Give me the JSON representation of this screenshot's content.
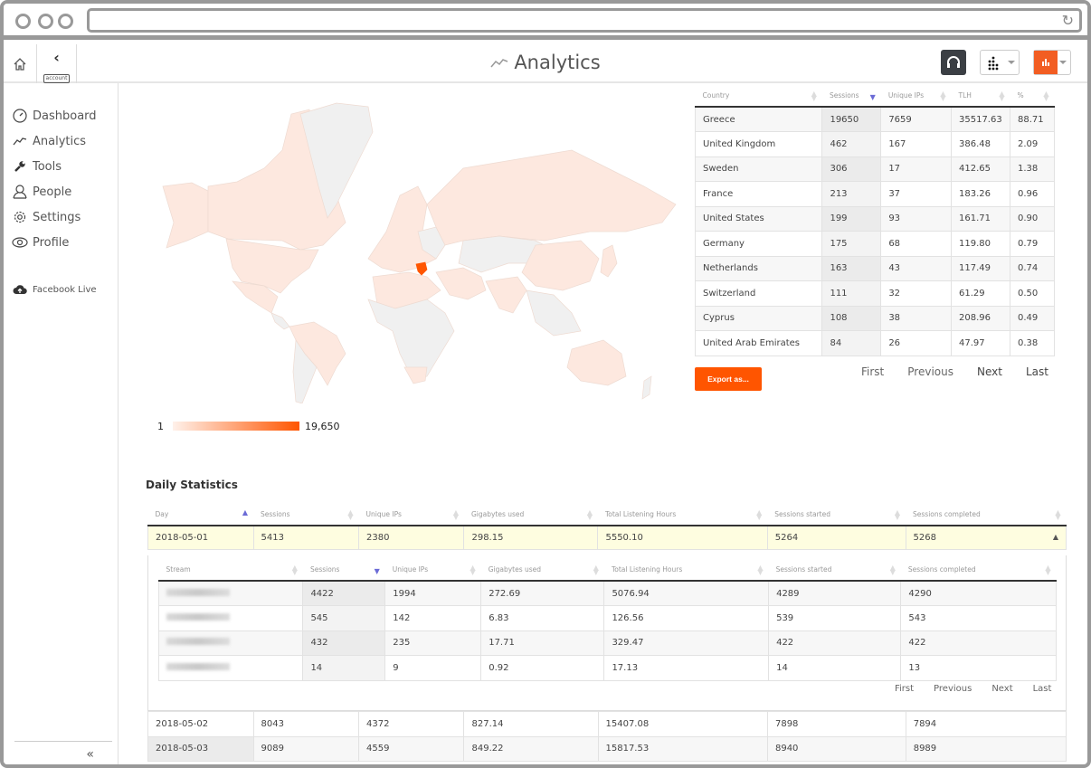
{
  "browser": {
    "url": "",
    "reload_icon": "reload-icon"
  },
  "header": {
    "home_icon": "home-icon",
    "back_icon": "chevron-left-icon",
    "back_label": "account",
    "title": "Analytics",
    "title_icon": "analytics-line-icon",
    "headphones_icon": "headphones-icon",
    "dropdown1_icon": "dots-grid-icon",
    "dropdown2_icon": "bar-chart-icon"
  },
  "sidebar": {
    "items": [
      {
        "label": "Dashboard",
        "icon": "dashboard-gauge-icon"
      },
      {
        "label": "Analytics",
        "icon": "analytics-line-icon"
      },
      {
        "label": "Tools",
        "icon": "wrench-icon"
      },
      {
        "label": "People",
        "icon": "person-icon"
      },
      {
        "label": "Settings",
        "icon": "gear-icon"
      },
      {
        "label": "Profile",
        "icon": "eye-icon"
      }
    ],
    "extra": {
      "label": "Facebook Live",
      "icon": "cloud-upload-icon"
    },
    "collapse_label": "«"
  },
  "map": {
    "legend_min": "1",
    "legend_max": "19,650",
    "highlight_country": "Greece",
    "colors": {
      "max": "#ff5500",
      "min": "#fde8df",
      "nodata": "#f0f0f0"
    }
  },
  "country_table": {
    "columns": [
      "Country",
      "Sessions",
      "Unique IPs",
      "TLH",
      "%"
    ],
    "sorted_column": "Sessions",
    "rows": [
      [
        "Greece",
        "19650",
        "7659",
        "35517.63",
        "88.71"
      ],
      [
        "United Kingdom",
        "462",
        "167",
        "386.48",
        "2.09"
      ],
      [
        "Sweden",
        "306",
        "17",
        "412.65",
        "1.38"
      ],
      [
        "France",
        "213",
        "37",
        "183.26",
        "0.96"
      ],
      [
        "United States",
        "199",
        "93",
        "161.71",
        "0.90"
      ],
      [
        "Germany",
        "175",
        "68",
        "119.80",
        "0.79"
      ],
      [
        "Netherlands",
        "163",
        "43",
        "117.49",
        "0.74"
      ],
      [
        "Switzerland",
        "111",
        "32",
        "61.29",
        "0.50"
      ],
      [
        "Cyprus",
        "108",
        "38",
        "208.96",
        "0.49"
      ],
      [
        "United Arab Emirates",
        "84",
        "26",
        "47.97",
        "0.38"
      ]
    ],
    "export_label": "Export as...",
    "pager": [
      "First",
      "Previous",
      "Next",
      "Last"
    ]
  },
  "daily": {
    "title": "Daily Statistics",
    "columns": [
      "Day",
      "Sessions",
      "Unique IPs",
      "Gigabytes used",
      "Total Listening Hours",
      "Sessions started",
      "Sessions completed"
    ],
    "expanded_row": [
      "2018-05-01",
      "5413",
      "2380",
      "298.15",
      "5550.10",
      "5264",
      "5268"
    ],
    "sub_table": {
      "columns": [
        "Stream",
        "Sessions",
        "Unique IPs",
        "Gigabytes used",
        "Total Listening Hours",
        "Sessions started",
        "Sessions completed"
      ],
      "rows": [
        [
          "",
          "4422",
          "1994",
          "272.69",
          "5076.94",
          "4289",
          "4290"
        ],
        [
          "",
          "545",
          "142",
          "6.83",
          "126.56",
          "539",
          "543"
        ],
        [
          "",
          "432",
          "235",
          "17.71",
          "329.47",
          "422",
          "422"
        ],
        [
          "",
          "14",
          "9",
          "0.92",
          "17.13",
          "14",
          "13"
        ]
      ],
      "pager": [
        "First",
        "Previous",
        "Next",
        "Last"
      ]
    },
    "rows": [
      [
        "2018-05-02",
        "8043",
        "4372",
        "827.14",
        "15407.08",
        "7898",
        "7894"
      ],
      [
        "2018-05-03",
        "9089",
        "4559",
        "849.22",
        "15817.53",
        "8940",
        "8989"
      ]
    ]
  }
}
